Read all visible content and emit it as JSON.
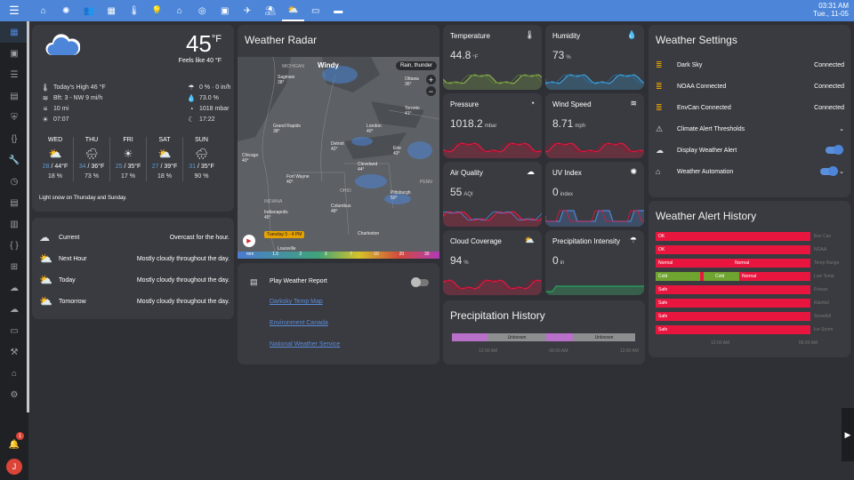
{
  "clock": {
    "time": "03:31 AM",
    "date": "Tue., 11-05"
  },
  "topbar_tabs": [
    "home-icon",
    "sun-icon",
    "people-icon",
    "calendar-icon",
    "thermometer-icon",
    "lightbulb-icon",
    "garage-icon",
    "washer-icon",
    "photo-icon",
    "airplane-icon",
    "beach-icon",
    "weather-partly-cloudy-icon",
    "computer-icon",
    "couch-icon"
  ],
  "sidebar_items": [
    "dashboard-icon",
    "inbox-icon",
    "list-icon",
    "book-icon",
    "shield-icon",
    "code-icon",
    "wrench-icon",
    "history-icon",
    "note-icon",
    "devices-icon",
    "braces-icon",
    "network-icon",
    "cloud-upload-icon",
    "cloud-icon",
    "terminal-icon",
    "tool-icon",
    "home-settings-icon",
    "gear-icon"
  ],
  "notifications": {
    "count": "1"
  },
  "user": {
    "initial": "J"
  },
  "weather": {
    "temp": "45",
    "unit": "°F",
    "feels": "Feels like 40 °F",
    "left_stats": [
      "Today's High 46 °F",
      "Bft: 3 - NW 9 mi/h",
      "10 mi",
      "07:07"
    ],
    "right_stats": [
      "0 % · 0 in/h",
      "73.0 %",
      "1018 mbar",
      "17:22"
    ],
    "forecast": [
      {
        "day": "WED",
        "icon": "partly-cloudy-icon",
        "glyph": "⛅",
        "hi": "28",
        "lo": "44°F",
        "precip": "18 %"
      },
      {
        "day": "THU",
        "icon": "rain-icon",
        "glyph": "🌧",
        "hi": "34",
        "lo": "36°F",
        "precip": "73 %"
      },
      {
        "day": "FRI",
        "icon": "sun-icon",
        "glyph": "☀",
        "hi": "25",
        "lo": "35°F",
        "precip": "17 %"
      },
      {
        "day": "SAT",
        "icon": "partly-cloudy-icon",
        "glyph": "⛅",
        "hi": "27",
        "lo": "39°F",
        "precip": "18 %"
      },
      {
        "day": "SUN",
        "icon": "rain-icon",
        "glyph": "🌧",
        "hi": "31",
        "lo": "35°F",
        "precip": "90 %"
      }
    ],
    "summary": "Light snow on Thursday and Sunday."
  },
  "conditions": [
    {
      "label": "Current",
      "value": "Overcast for the hour."
    },
    {
      "label": "Next Hour",
      "value": "Mostly cloudy throughout the day."
    },
    {
      "label": "Today",
      "value": "Mostly cloudy throughout the day."
    },
    {
      "label": "Tomorrow",
      "value": "Mostly cloudy throughout the day."
    }
  ],
  "radar": {
    "title": "Weather Radar",
    "brand": "Windy",
    "weather_tag": "Rain, thunder",
    "time_pill": "Tuesday 5 - 4 PM",
    "scale": [
      "mm",
      "1.5",
      "2",
      "3",
      "7",
      "10",
      "20",
      "30"
    ],
    "cities": [
      {
        "name": "Saginaw",
        "temp": "38°"
      },
      {
        "name": "Ottawa",
        "temp": "36°"
      },
      {
        "name": "Grand Rapids",
        "temp": "38°"
      },
      {
        "name": "London",
        "temp": "40°"
      },
      {
        "name": "Toronto",
        "temp": "41°"
      },
      {
        "name": "Chicago",
        "temp": "40°"
      },
      {
        "name": "Detroit",
        "temp": "42°"
      },
      {
        "name": "Erie",
        "temp": "43°"
      },
      {
        "name": "Cleveland",
        "temp": "44°"
      },
      {
        "name": "Fort Wayne",
        "temp": "40°"
      },
      {
        "name": "Pittsburgh",
        "temp": "50°"
      },
      {
        "name": "Columbus",
        "temp": "48°"
      },
      {
        "name": "Indianapolis",
        "temp": "45°"
      },
      {
        "name": "Charleston",
        "temp": ""
      },
      {
        "name": "Louisville",
        "temp": ""
      }
    ],
    "regions": [
      "MICHIGAN",
      "OHIO",
      "INDIANA",
      "PENN"
    ]
  },
  "links": {
    "play_label": "Play Weather Report",
    "items": [
      "Darksky Temp Map",
      "Environment Canada",
      "National Weather Service"
    ]
  },
  "sensors": [
    {
      "title": "Temperature",
      "icon": "thermometer-icon",
      "glyph": "🌡",
      "value": "44.8",
      "unit": "°F"
    },
    {
      "title": "Humidity",
      "icon": "water-percent-icon",
      "glyph": "💧",
      "value": "73",
      "unit": "%"
    },
    {
      "title": "Pressure",
      "icon": "gauge-icon",
      "glyph": "◔",
      "value": "1018.2",
      "unit": "mbar"
    },
    {
      "title": "Wind Speed",
      "icon": "wind-icon",
      "glyph": "≋",
      "value": "8.71",
      "unit": "mph"
    },
    {
      "title": "Air Quality",
      "icon": "cloud-icon",
      "glyph": "☁",
      "value": "55",
      "unit": "AQI"
    },
    {
      "title": "UV Index",
      "icon": "sun-icon",
      "glyph": "✺",
      "value": "0",
      "unit": "index"
    },
    {
      "title": "Cloud Coverage",
      "icon": "partly-cloudy-night-icon",
      "glyph": "⛅",
      "value": "94",
      "unit": "%"
    },
    {
      "title": "Precipitation Intensity",
      "icon": "cloud-rain-icon",
      "glyph": "☂",
      "value": "0",
      "unit": "in"
    }
  ],
  "precip_history": {
    "title": "Precipitation History",
    "labels": [
      "Unknown",
      "Unknown"
    ],
    "times": [
      "12:00 AM",
      "06:00 AM",
      "12:00 AM"
    ]
  },
  "settings": {
    "title": "Weather Settings",
    "rows": [
      {
        "icon": "server-icon",
        "label": "Dark Sky",
        "value": "Connected"
      },
      {
        "icon": "server-icon",
        "label": "NOAA Connected",
        "value": "Connected"
      },
      {
        "icon": "server-icon",
        "label": "EnvCan Connected",
        "value": "Connected"
      },
      {
        "icon": "alert-icon",
        "label": "Climate Alert Thresholds",
        "value": ""
      },
      {
        "icon": "cloud-alert-icon",
        "label": "Display Weather Alert",
        "value": ""
      },
      {
        "icon": "automation-icon",
        "label": "Weather Automation",
        "value": ""
      }
    ]
  },
  "alerts": {
    "title": "Weather Alert History",
    "rows": [
      {
        "label": "Env Can",
        "segs": [
          [
            "OK",
            174,
            "#e8163f"
          ]
        ]
      },
      {
        "label": "NOAA",
        "segs": [
          [
            "OK",
            174,
            "#e8163f"
          ]
        ]
      },
      {
        "label": "Temp Range",
        "segs": [
          [
            "Normal",
            86,
            "#e8163f"
          ],
          [
            "Normal",
            88,
            "#e8163f"
          ]
        ]
      },
      {
        "label": "Low Temp",
        "segs": [
          [
            "Cold",
            50,
            "#6ea42f"
          ],
          [
            "",
            4,
            "#e8163f"
          ],
          [
            "",
            10,
            "#6ea42f"
          ],
          [
            "Cold",
            30,
            "#6ea42f"
          ],
          [
            "Normal",
            80,
            "#e8163f"
          ]
        ]
      },
      {
        "label": "Freeze",
        "segs": [
          [
            "Safe",
            174,
            "#e8163f"
          ]
        ]
      },
      {
        "label": "Rainfall",
        "segs": [
          [
            "Safe",
            174,
            "#e8163f"
          ]
        ]
      },
      {
        "label": "Snowfall",
        "segs": [
          [
            "Safe",
            174,
            "#e8163f"
          ]
        ]
      },
      {
        "label": "Ice Storm",
        "segs": [
          [
            "Safe",
            174,
            "#e8163f"
          ]
        ]
      }
    ],
    "times": [
      "12:00 AM",
      "06:00 AM"
    ]
  }
}
